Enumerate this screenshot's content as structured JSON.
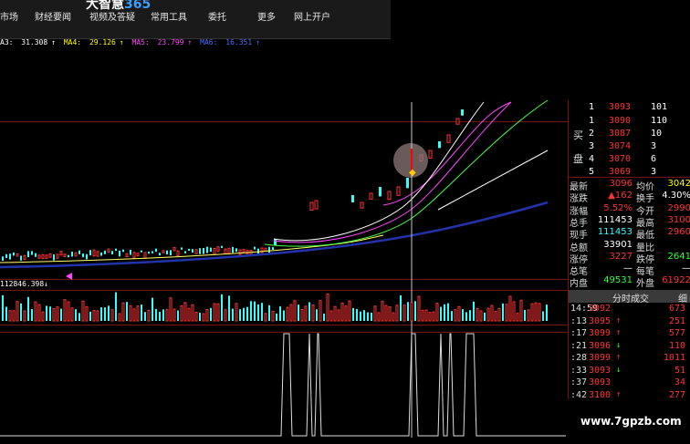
{
  "menubar": {
    "brand": "大智慧",
    "brand_suffix": "365",
    "items": [
      "市场",
      "财经要闻",
      "视频及答疑",
      "常用工具",
      "委托",
      "更多",
      "网上开户"
    ]
  },
  "ma_line": [
    {
      "label": "A3:",
      "value": "31.308",
      "color": "#ffffff"
    },
    {
      "label": "MA4:",
      "value": "29.126",
      "color": "#ffff00"
    },
    {
      "label": "MA5:",
      "value": "23.799",
      "color": "#ff44ff"
    },
    {
      "label": "MA6:",
      "value": "16.351",
      "color": "#4a6bff"
    }
  ],
  "volume_label": "112846.398",
  "order_book": {
    "side_labels": {
      "buy1": "买",
      "buy2": "盘"
    },
    "rows": [
      {
        "idx": "1",
        "price": "3093",
        "vol": "101"
      },
      {
        "idx": "1",
        "price": "3090",
        "vol": "110"
      },
      {
        "idx": "2",
        "price": "3087",
        "vol": "10"
      },
      {
        "idx": "3",
        "price": "3074",
        "vol": "3"
      },
      {
        "idx": "4",
        "price": "3070",
        "vol": "6"
      },
      {
        "idx": "5",
        "price": "3069",
        "vol": "3"
      }
    ]
  },
  "stats": [
    {
      "k1": "最新",
      "v1": "3096",
      "c1": "red",
      "k2": "均价",
      "v2": "3042",
      "c2": "yel"
    },
    {
      "k1": "涨跌",
      "v1": "▲162",
      "c1": "red",
      "k2": "换手",
      "v2": "4.30%",
      "c2": "wht"
    },
    {
      "k1": "涨幅",
      "v1": "5.52%",
      "c1": "red",
      "k2": "今开",
      "v2": "2990",
      "c2": "red"
    },
    {
      "k1": "总手",
      "v1": "111453",
      "c1": "wht",
      "k2": "最高",
      "v2": "3100",
      "c2": "red"
    },
    {
      "k1": "现手",
      "v1": "111453",
      "c1": "cyan",
      "k2": "最低",
      "v2": "2960",
      "c2": "red"
    },
    {
      "k1": "总额",
      "v1": "33901",
      "c1": "wht",
      "k2": "量比",
      "v2": "",
      "c2": "wht"
    },
    {
      "k1": "涨停",
      "v1": "3227",
      "c1": "red",
      "k2": "跌停",
      "v2": "2641",
      "c2": "grn"
    },
    {
      "k1": "总笔",
      "v1": "—",
      "c1": "wht",
      "k2": "每笔",
      "v2": "—",
      "c2": "wht"
    },
    {
      "k1": "内盘",
      "v1": "49531",
      "c1": "grn",
      "k2": "外盘",
      "v2": "61922",
      "c2": "red"
    }
  ],
  "ticks": {
    "header": "分时成交",
    "header_extra": "细",
    "rows": [
      {
        "t": "14:59",
        "p": "3092",
        "a": "",
        "ac": "red",
        "v": "673"
      },
      {
        "t": ":13",
        "p": "3095",
        "a": "↑",
        "ac": "red",
        "v": "251"
      },
      {
        "t": ":17",
        "p": "3099",
        "a": "↑",
        "ac": "red",
        "v": "577"
      },
      {
        "t": ":21",
        "p": "3096",
        "a": "↓",
        "ac": "grn",
        "v": "110"
      },
      {
        "t": ":28",
        "p": "3099",
        "a": "↑",
        "ac": "red",
        "v": "1011"
      },
      {
        "t": ":33",
        "p": "3093",
        "a": "↓",
        "ac": "grn",
        "v": "51"
      },
      {
        "t": ":37",
        "p": "3093",
        "a": "",
        "ac": "red",
        "v": "34"
      },
      {
        "t": ":42",
        "p": "3100",
        "a": "↑",
        "ac": "red",
        "v": "277"
      }
    ]
  },
  "watermark": "www.7gpzb.com",
  "colors": {
    "up": "#ff3333",
    "down": "#33ffff",
    "grid": "#7a1010",
    "ma_blue": "#2233aa"
  }
}
